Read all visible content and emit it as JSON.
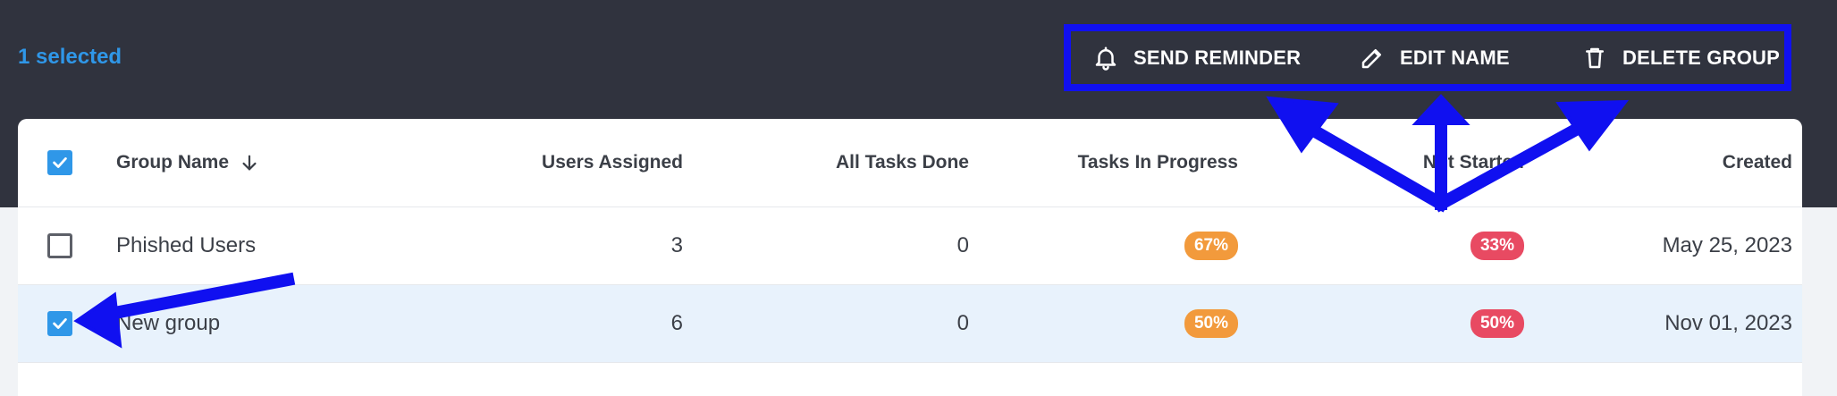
{
  "toolbar": {
    "selected_text": "1 selected",
    "actions": [
      {
        "label": "SEND REMINDER",
        "icon": "bell-icon"
      },
      {
        "label": "EDIT NAME",
        "icon": "pencil-icon"
      },
      {
        "label": "DELETE GROUP",
        "icon": "trash-icon"
      }
    ]
  },
  "table": {
    "columns": [
      "Group Name",
      "Users Assigned",
      "All Tasks Done",
      "Tasks In Progress",
      "Not Started",
      "Created"
    ],
    "sort_column": "Group Name",
    "sort_direction": "descending",
    "header_checked": true,
    "rows": [
      {
        "checked": false,
        "name": "Phished Users",
        "users": "3",
        "done": "0",
        "in_progress": "67%",
        "not_started": "33%",
        "created": "May 25, 2023"
      },
      {
        "checked": true,
        "name": "New group",
        "users": "6",
        "done": "0",
        "in_progress": "50%",
        "not_started": "50%",
        "created": "Nov 01, 2023"
      }
    ]
  },
  "colors": {
    "topbar": "#30333e",
    "accent": "#2f97e8",
    "annotation": "#1010f0",
    "badge_orange": "#f29a3c",
    "badge_red": "#e84a62",
    "selected_row": "#e8f2fc"
  }
}
